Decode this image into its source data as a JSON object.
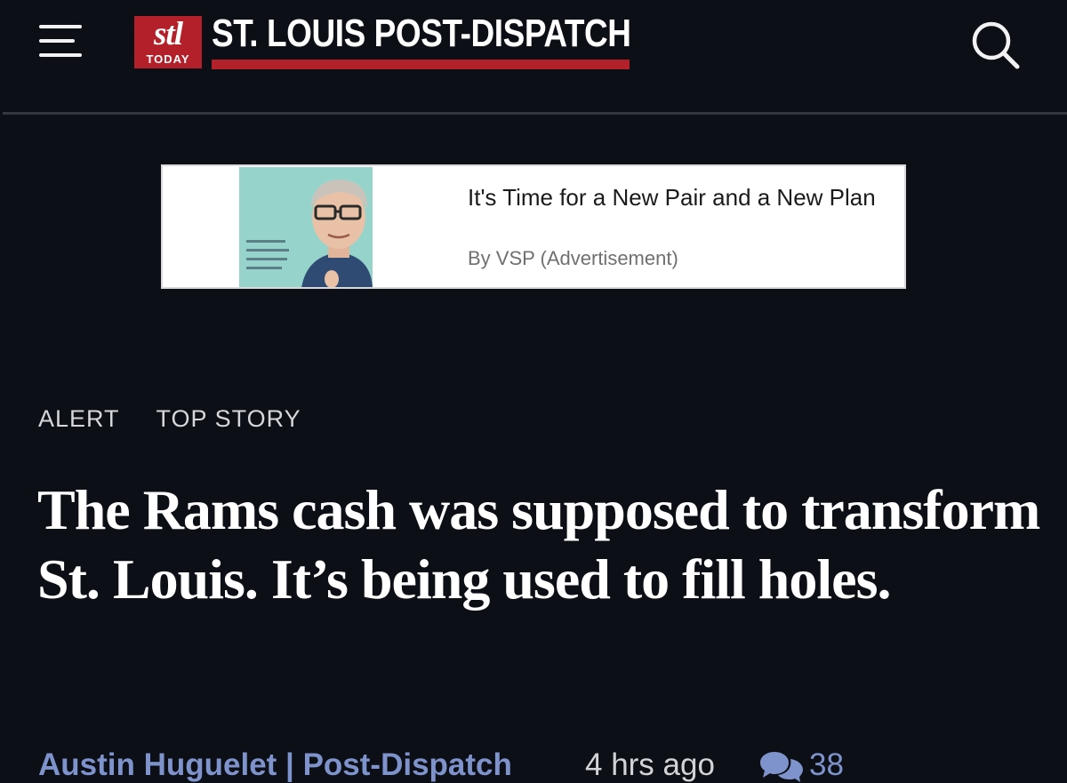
{
  "header": {
    "logo_mark": "stl",
    "logo_sub": "TODAY",
    "masthead": "ST. LOUIS POST-DISPATCH",
    "menu_icon": "hamburger-menu-icon",
    "search_icon": "search-icon",
    "brand_color": "#b3202a"
  },
  "ad": {
    "headline": "It's Time for a New Pair and a New Plan",
    "byline": "By VSP (Advertisement)"
  },
  "tags": [
    "ALERT",
    "TOP STORY"
  ],
  "article": {
    "headline": "The Rams cash was supposed to transform St. Louis. It’s being used to fill holes.",
    "author": "Austin Huguelet | Post-Dispatch",
    "time_ago": "4 hrs ago",
    "comment_icon": "comments-icon",
    "comment_count": "38",
    "link_color": "#7e93cc"
  }
}
